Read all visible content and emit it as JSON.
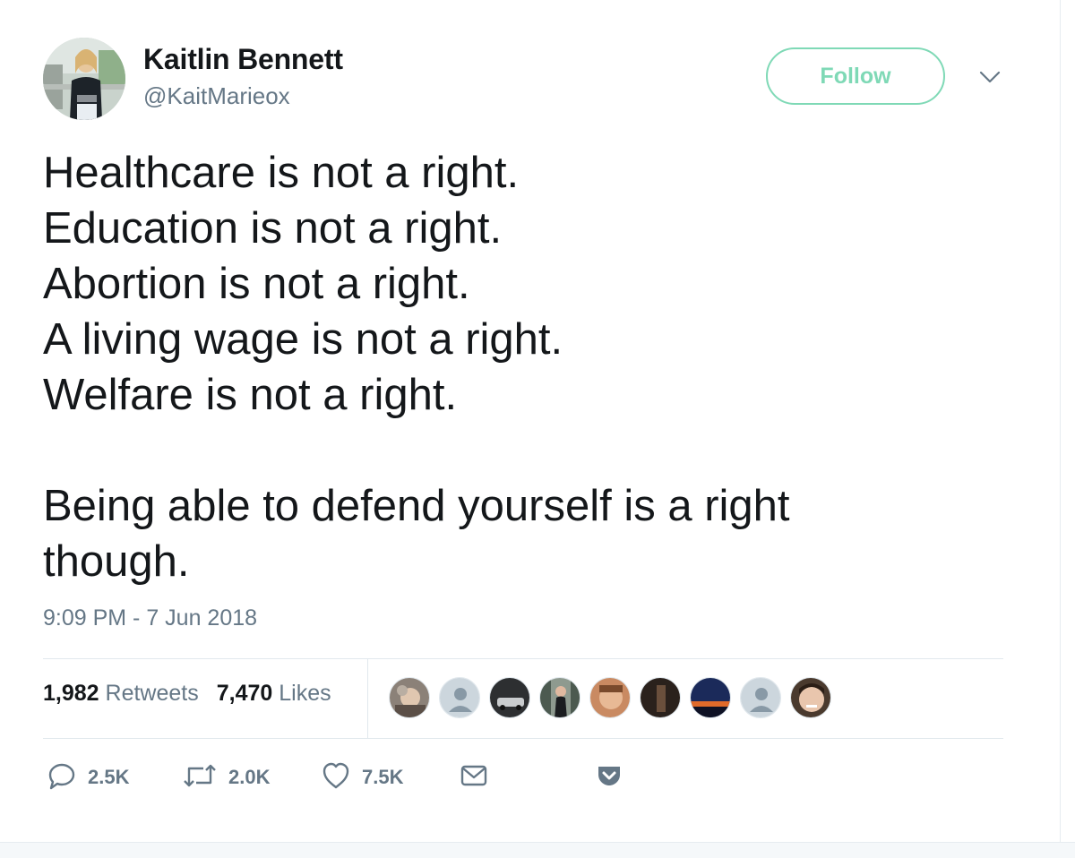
{
  "user": {
    "display_name": "Kaitlin Bennett",
    "handle": "@KaitMarieox"
  },
  "header": {
    "follow_label": "Follow",
    "menu_icon": "chevron-down-icon"
  },
  "tweet": {
    "lines": [
      "Healthcare is not a right.",
      "Education is not a right.",
      "Abortion is not a right.",
      "A living wage is not a right.",
      "Welfare is not a right."
    ],
    "closing_lines": [
      "Being able to defend yourself is a right",
      "though."
    ],
    "timestamp": "9:09 PM - 7 Jun 2018"
  },
  "stats": {
    "retweets_count": "1,982",
    "retweets_label": "Retweets",
    "likes_count": "7,470",
    "likes_label": "Likes"
  },
  "likers_count": 9,
  "actions": {
    "reply_count": "2.5K",
    "retweet_count": "2.0K",
    "like_count": "7.5K"
  },
  "colors": {
    "accent": "#7fd9b6",
    "text": "#14171a",
    "muted": "#657786",
    "divider": "#e1e8ed"
  }
}
